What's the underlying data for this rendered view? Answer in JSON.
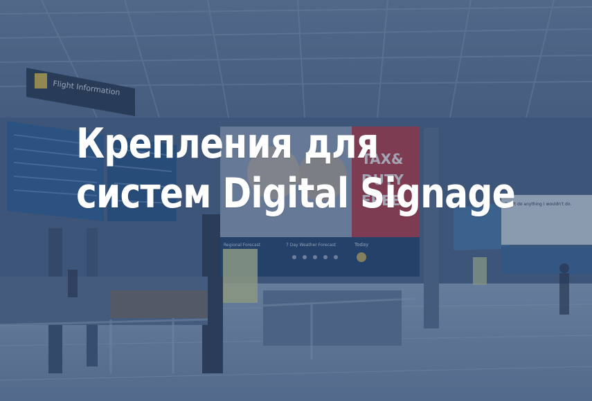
{
  "headline": {
    "line1": "Крепления для",
    "line2": "систем Digital Signage"
  },
  "background": {
    "ad_panel_line1": "TAX&",
    "ad_panel_line2": "DUTY",
    "ad_panel_line3": "FREE",
    "flight_sign": "Flight Information",
    "weather_strip_left": "Regional Forecast",
    "weather_strip_mid": "7 Day Weather Forecast",
    "weather_strip_right": "Today",
    "side_screen_text": "Don't do anything I wouldn't do."
  },
  "colors": {
    "overlay": "#263c60",
    "headline": "#ffffff",
    "accent_red": "#c7323a"
  }
}
